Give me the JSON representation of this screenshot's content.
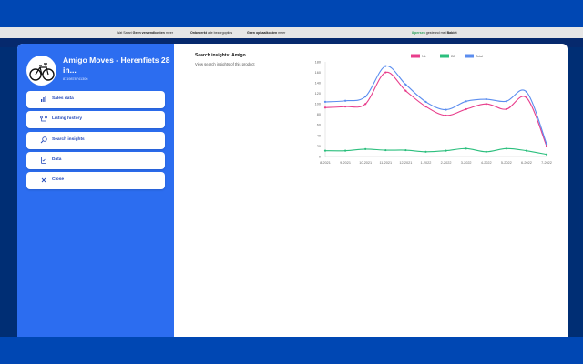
{
  "page": {
    "usp": [
      {
        "prefix": "Wat Safari",
        "bold": "Geen verzendkosten",
        "suffix": "meer"
      },
      {
        "prefix": "",
        "bold": "Onbeperkt",
        "suffix": "alle bezorgopties"
      },
      {
        "prefix": "",
        "bold": "Geen ophaalkosten",
        "suffix": "meer"
      }
    ],
    "usp_right": {
      "prefix": "8 persen",
      "mid": "gesteund met",
      "brand": "Babiet"
    }
  },
  "product": {
    "title": "Amigo Moves - Herenfiets 28 in...",
    "ean": "8719878741306"
  },
  "menu": [
    {
      "label": "Sales data",
      "icon": "bar-chart-icon"
    },
    {
      "label": "Listing history",
      "icon": "history-icon"
    },
    {
      "label": "Search insights",
      "icon": "search-icon"
    },
    {
      "label": "Data",
      "icon": "data-icon"
    },
    {
      "label": "Close",
      "icon": "close-icon"
    }
  ],
  "main": {
    "title": "Search insights: Amigo",
    "subtitle": "View search insights of this product"
  },
  "colors": {
    "primary": "#2c6df0",
    "nl": "#e83e8c",
    "be": "#2bbf7d",
    "total": "#5b8def"
  },
  "chart_data": {
    "type": "line",
    "x": [
      "8-2021",
      "9-2021",
      "10-2021",
      "11-2021",
      "12-2021",
      "1-2022",
      "2-2022",
      "3-2022",
      "4-2022",
      "5-2022",
      "6-2022",
      "7-2022"
    ],
    "ylim": [
      0,
      180
    ],
    "yticks": [
      0,
      20,
      40,
      60,
      80,
      100,
      120,
      140,
      160,
      180
    ],
    "grid": false,
    "legend_position": "top",
    "series": [
      {
        "name": "NL",
        "values": [
          93,
          95,
          100,
          160,
          125,
          95,
          78,
          90,
          100,
          90,
          112,
          20
        ]
      },
      {
        "name": "BE",
        "values": [
          11,
          11,
          14,
          12,
          12,
          9,
          11,
          15,
          9,
          15,
          11,
          4
        ]
      },
      {
        "name": "Total",
        "values": [
          104,
          106,
          114,
          172,
          137,
          104,
          89,
          105,
          109,
          105,
          123,
          24
        ]
      }
    ]
  }
}
